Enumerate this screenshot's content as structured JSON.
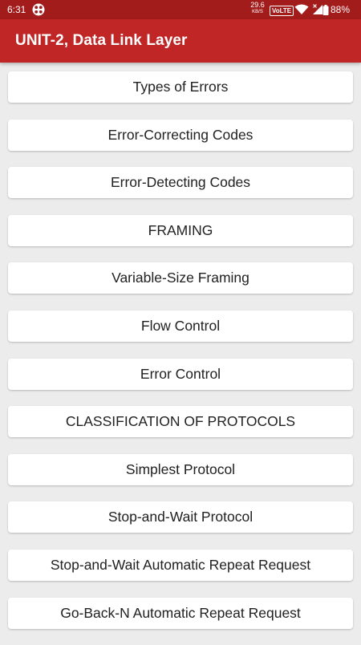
{
  "status_bar": {
    "time": "6:31",
    "net_speed_value": "29.6",
    "net_speed_unit": "KB/S",
    "volte": "VoLTE",
    "battery": "88%",
    "icons": [
      "app-notification-icon",
      "wifi-icon",
      "signal-icon",
      "battery-icon"
    ]
  },
  "app_bar": {
    "title": "UNIT-2, Data Link Layer",
    "color": "#c02626"
  },
  "topics": [
    "Types of Errors",
    "Error-Correcting Codes",
    "Error-Detecting Codes",
    "FRAMING",
    "Variable-Size Framing",
    "Flow Control",
    "Error Control",
    "CLASSIFICATION OF PROTOCOLS",
    "Simplest Protocol",
    "Stop-and-Wait Protocol",
    "Stop-and-Wait Automatic Repeat Request",
    "Go-Back-N Automatic Repeat Request"
  ]
}
